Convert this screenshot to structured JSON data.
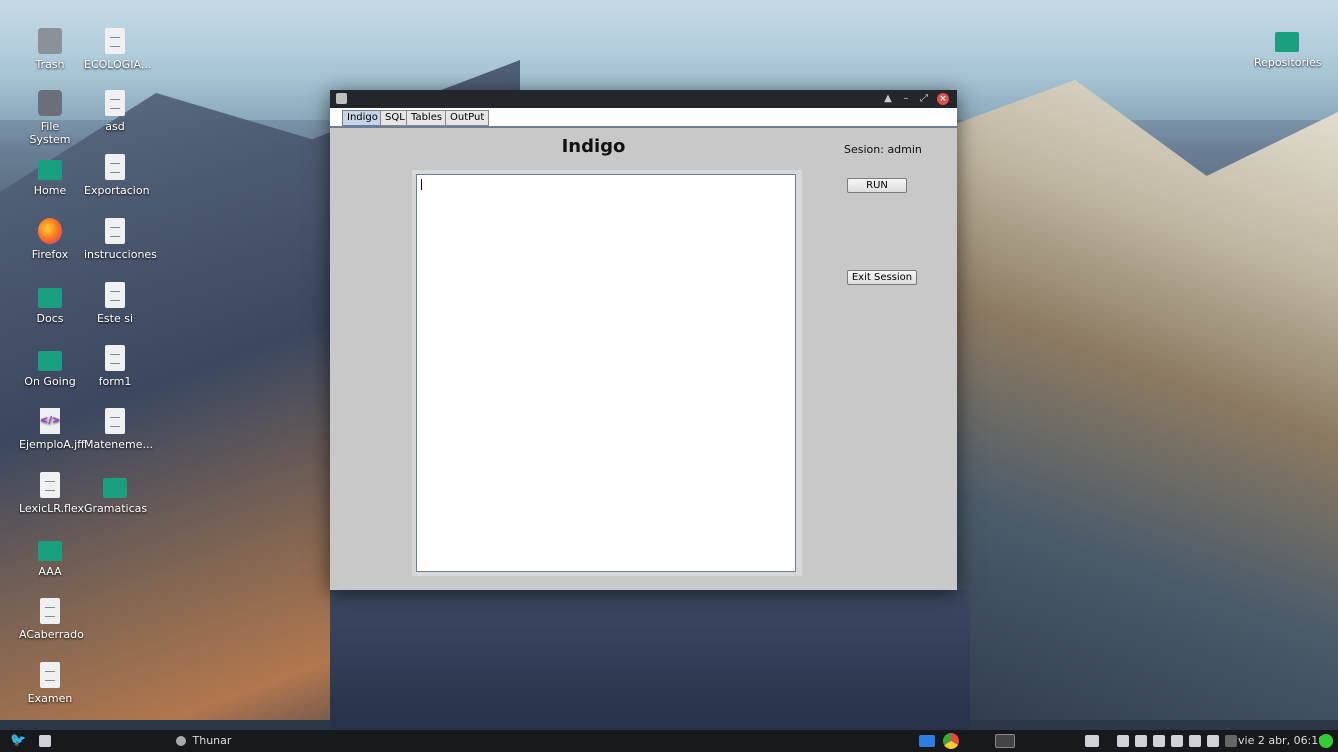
{
  "desktop": {
    "icons_left": [
      {
        "label": "Trash",
        "icon": "trash-icon"
      },
      {
        "label": "ECOLOGIA...",
        "icon": "file-icon"
      },
      {
        "label": "File System",
        "icon": "filesystem-icon"
      },
      {
        "label": "asd",
        "icon": "file-icon"
      },
      {
        "label": "Home",
        "icon": "home-folder-icon"
      },
      {
        "label": "Exportacion",
        "icon": "file-icon"
      },
      {
        "label": "Firefox",
        "icon": "firefox-icon"
      },
      {
        "label": "instrucciones",
        "icon": "file-icon"
      },
      {
        "label": "Docs",
        "icon": "folder-icon"
      },
      {
        "label": "Este si",
        "icon": "file-icon"
      },
      {
        "label": "On Going",
        "icon": "folder-icon"
      },
      {
        "label": "form1",
        "icon": "file-icon"
      },
      {
        "label": "EjemploA.jff",
        "icon": "xml-file-icon"
      },
      {
        "label": "Mateneme...",
        "icon": "file-icon"
      },
      {
        "label": "LexicLR.flex",
        "icon": "file-icon"
      },
      {
        "label": "Gramaticas",
        "icon": "folder-icon"
      },
      {
        "label": "AAA",
        "icon": "folder-icon"
      },
      {
        "label": "ACaberrado",
        "icon": "file-icon"
      },
      {
        "label": "Examen",
        "icon": "file-icon"
      }
    ],
    "icon_right": {
      "label": "Repositories",
      "icon": "folder-icon"
    }
  },
  "window": {
    "title": "",
    "tabs": [
      {
        "label": "Indigo",
        "active": true
      },
      {
        "label": "SQL",
        "active": false
      },
      {
        "label": "Tables",
        "active": false
      },
      {
        "label": "OutPut",
        "active": false
      }
    ],
    "heading": "Indigo",
    "session": "Sesion: admin",
    "editor_value": "",
    "run_label": "RUN",
    "exit_label": "Exit Session"
  },
  "taskbar": {
    "task": "Thunar",
    "clock": "vie 2 abr, 06:10"
  },
  "colors": {
    "accent": "#6a7d9a",
    "folder": "#1aa07e",
    "close": "#e04e4e"
  }
}
